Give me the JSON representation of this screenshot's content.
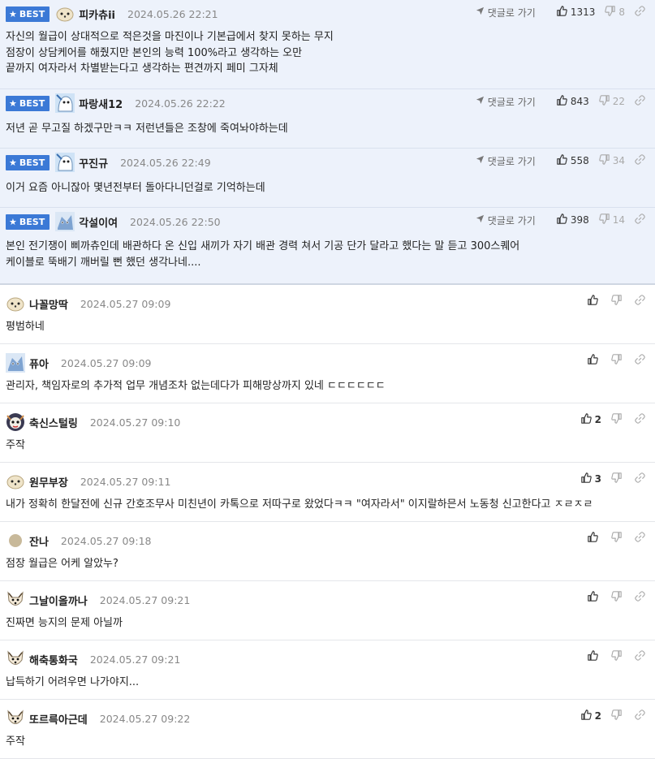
{
  "best_label": "BEST",
  "reply_label": "댓글로 가기",
  "best_comments": [
    {
      "nick": "피카츄ii",
      "date": "2024.05.26 22:21",
      "up": "1313",
      "down": "8",
      "lines": [
        "자신의 월급이 상대적으로 적은것을 마진이나 기본급에서 찾지 못하는 무지",
        "점장이 상담케어를 해줬지만 본인의 능력 100%라고 생각하는 오만",
        "끝까지 여자라서 차별받는다고 생각하는 편견까지 페미 그자체"
      ]
    },
    {
      "nick": "파랑새12",
      "date": "2024.05.26 22:22",
      "up": "843",
      "down": "22",
      "lines": [
        "저년 곧 무고질 하겠구만ㅋㅋ 저런년들은 조창에 죽여놔야하는데"
      ]
    },
    {
      "nick": "꾸진규",
      "date": "2024.05.26 22:49",
      "up": "558",
      "down": "34",
      "lines": [
        "이거 요즘 아니잖아 몇년전부터 돌아다니던걸로 기억하는데"
      ]
    },
    {
      "nick": "각설이여",
      "date": "2024.05.26 22:50",
      "up": "398",
      "down": "14",
      "lines": [
        "본인 전기쟁이 삐까츄인데 배관하다 온 신입 새끼가 자기 배관 경력 쳐서 기공 단가 달라고 했다는 말 듣고 300스퀘어",
        "케이블로 뚝배기 깨버릴 뻔 했던 생각나네...."
      ]
    }
  ],
  "comments": [
    {
      "nick": "나꼴망딱",
      "date": "2024.05.27 09:09",
      "up": "",
      "text": "평범하네"
    },
    {
      "nick": "퓨아",
      "date": "2024.05.27 09:09",
      "up": "",
      "text": "관리자, 책임자로의 추가적 업무 개념조차 없는데다가 피해망상까지 있네 ㄷㄷㄷㄷㄷㄷ"
    },
    {
      "nick": "축신스털링",
      "date": "2024.05.27 09:10",
      "up": "2",
      "text": "주작"
    },
    {
      "nick": "원무부장",
      "date": "2024.05.27 09:11",
      "up": "3",
      "text": "내가 정확히 한달전에 신규 간호조무사 미친년이 카톡으로 저따구로 왔었다ㅋㅋ \"여자라서\" 이지랄하믄서 노동청 신고한다고 ㅈㄹㅈㄹ"
    },
    {
      "nick": "잔나",
      "date": "2024.05.27 09:18",
      "up": "",
      "text": "점장 월급은 어케 알았누?"
    },
    {
      "nick": "그날이올까나",
      "date": "2024.05.27 09:21",
      "up": "",
      "text": "진짜면 능지의 문제 아닐까"
    },
    {
      "nick": "해축통화국",
      "date": "2024.05.27 09:21",
      "up": "",
      "text": "납득하기 어려우면 나가야지..."
    },
    {
      "nick": "또르륵아근데",
      "date": "2024.05.27 09:22",
      "up": "2",
      "text": "주작"
    }
  ]
}
